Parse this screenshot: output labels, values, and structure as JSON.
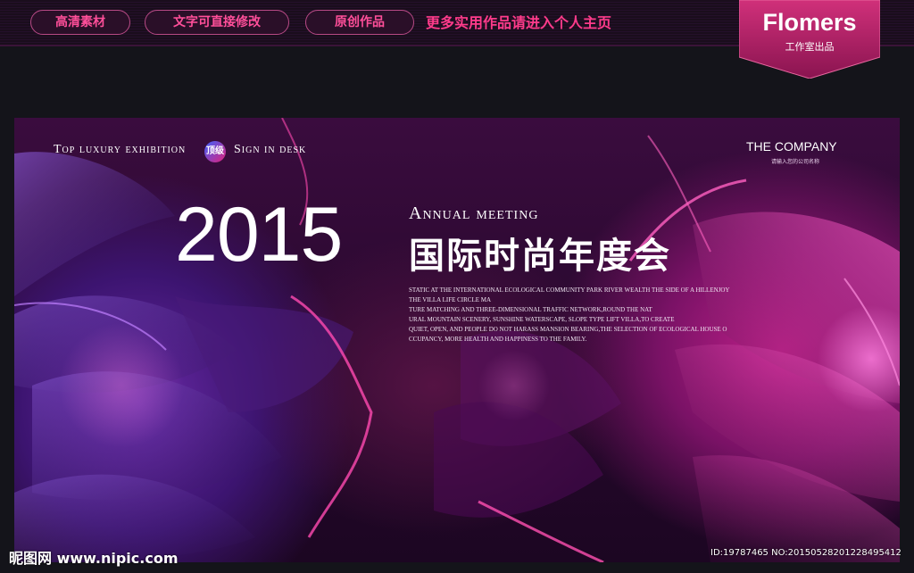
{
  "top_bar": {
    "pills": [
      "高清素材",
      "文字可直接修改",
      "原创作品"
    ],
    "promo": "更多实用作品请进入个人主页",
    "brand_name": "Flomers",
    "brand_sub": "工作室出品"
  },
  "banner": {
    "top_left_part1": "Top luxury exhibition",
    "badge": "顶级",
    "top_left_part2": "Sign in desk",
    "company": "THE COMPANY",
    "company_sub": "请输入您的公司名称",
    "year": "2015",
    "annual": "Annual meeting",
    "cn_title": "国际时尚年度会",
    "desc_lines": [
      "STATIC AT THE INTERNATIONAL ECOLOGICAL COMMUNITY PARK RIVER WEALTH THE SIDE OF A HILLENJOY",
      "THE VILLA LIFE CIRCLE MA",
      "TURE MATCHING AND THREE-DIMENSIONAL TRAFFIC NETWORK,ROUND THE NAT",
      "URAL MOUNTAIN SCENERY, SUNSHINE WATERSCAPE, SLOPE TYPE LIFT VILLA,TO CREATE",
      "QUIET, OPEN, AND PEOPLE DO NOT HARASS MANSION BEARING,THE SELECTION OF ECOLOGICAL HOUSE O",
      "CCUPANCY, MORE HEALTH AND HAPPINESS TO THE FAMILY."
    ]
  },
  "watermark": {
    "left": "昵图网 www.nipic.com",
    "right": "ID:19787465 NO:20150528201228495412"
  },
  "colors": {
    "accent": "#ff3b8b",
    "banner_base": "#2a0a30"
  }
}
